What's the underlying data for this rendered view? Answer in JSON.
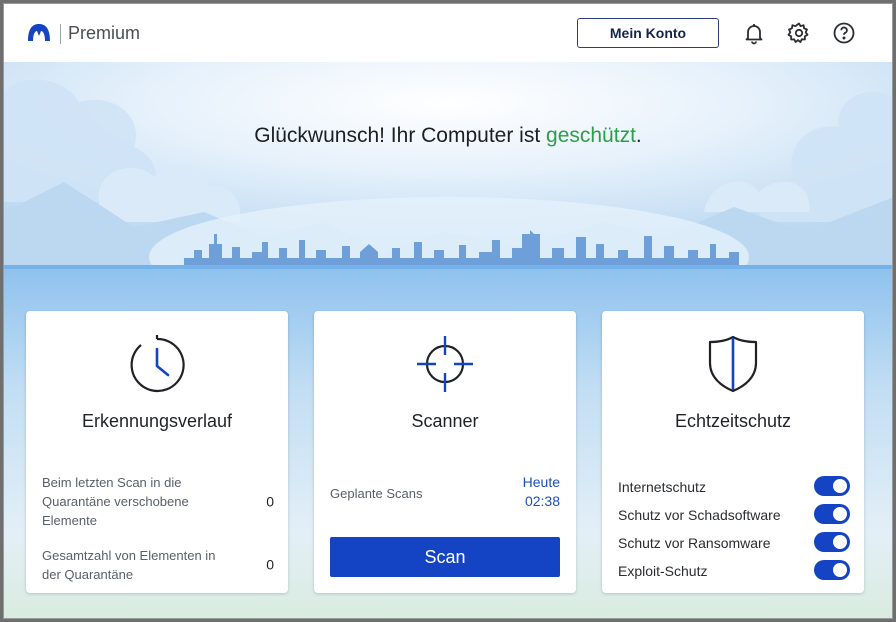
{
  "header": {
    "brand": "Premium",
    "account_button": "Mein Konto",
    "icons": [
      "bell-icon",
      "gear-icon",
      "help-icon"
    ]
  },
  "hero": {
    "title_prefix": "Glückwunsch! Ihr Computer ist ",
    "title_status": "geschützt",
    "title_suffix": ".",
    "status_color": "#2e9e4a"
  },
  "cards": {
    "history": {
      "title": "Erkennungsverlauf",
      "icon": "history-clock-icon",
      "rows": [
        {
          "label": "Beim letzten Scan in die Quarantäne verschobene Elemente",
          "value": "0"
        },
        {
          "label": "Gesamtzahl von Elementen in der Quarantäne",
          "value": "0"
        }
      ]
    },
    "scanner": {
      "title": "Scanner",
      "icon": "crosshair-icon",
      "scheduled_label": "Geplante Scans",
      "scheduled_day": "Heute",
      "scheduled_time": "02:38",
      "scan_button": "Scan"
    },
    "realtime": {
      "title": "Echtzeitschutz",
      "icon": "shield-icon",
      "toggles": [
        {
          "label": "Internetschutz",
          "on": true
        },
        {
          "label": "Schutz vor Schadsoftware",
          "on": true
        },
        {
          "label": "Schutz vor Ransomware",
          "on": true
        },
        {
          "label": "Exploit-Schutz",
          "on": true
        }
      ]
    }
  },
  "colors": {
    "accent": "#1444c4",
    "brand": "#1c4fb8",
    "ok": "#2e9e4a"
  }
}
